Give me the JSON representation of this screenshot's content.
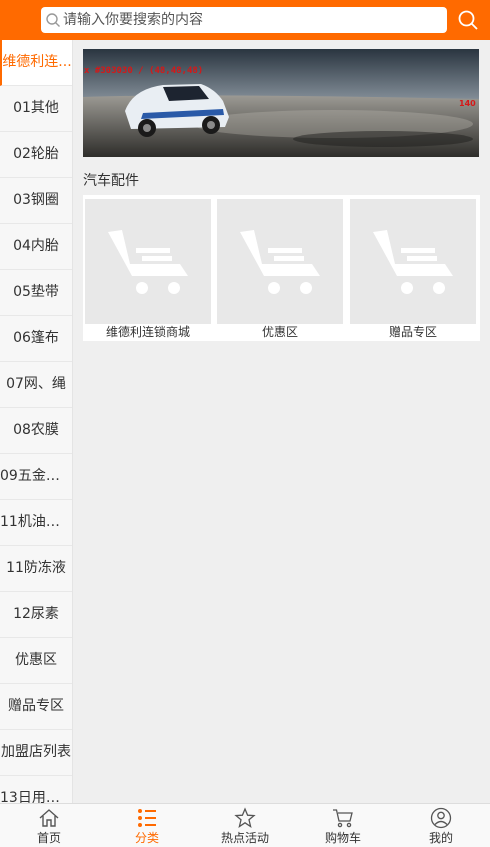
{
  "search": {
    "placeholder": "请输入你要搜索的内容"
  },
  "sidebar": {
    "items": [
      {
        "label": "维德利连..."
      },
      {
        "label": "01其他"
      },
      {
        "label": "02轮胎"
      },
      {
        "label": "03钢圈"
      },
      {
        "label": "04内胎"
      },
      {
        "label": "05垫带"
      },
      {
        "label": "06篷布"
      },
      {
        "label": "07网、绳"
      },
      {
        "label": "08农膜"
      },
      {
        "label": "09五金、..."
      },
      {
        "label": "11机油、..."
      },
      {
        "label": "11防冻液"
      },
      {
        "label": "12尿素"
      },
      {
        "label": "优惠区"
      },
      {
        "label": "赠品专区"
      },
      {
        "label": "加盟店列表"
      },
      {
        "label": "13日用百..."
      }
    ]
  },
  "banner": {
    "overlay_text": "x #303030 / (48,48,48)",
    "corner_text": "140"
  },
  "section": {
    "title": "汽车配件"
  },
  "tiles": [
    {
      "label": "维德利连锁商城"
    },
    {
      "label": "优惠区"
    },
    {
      "label": "赠品专区"
    }
  ],
  "bottom_nav": [
    {
      "label": "首页",
      "icon": "home-icon"
    },
    {
      "label": "分类",
      "icon": "category-icon"
    },
    {
      "label": "热点活动",
      "icon": "star-icon"
    },
    {
      "label": "购物车",
      "icon": "cart-icon"
    },
    {
      "label": "我的",
      "icon": "user-icon"
    }
  ],
  "colors": {
    "accent": "#ff6a00",
    "background": "#efefef"
  }
}
